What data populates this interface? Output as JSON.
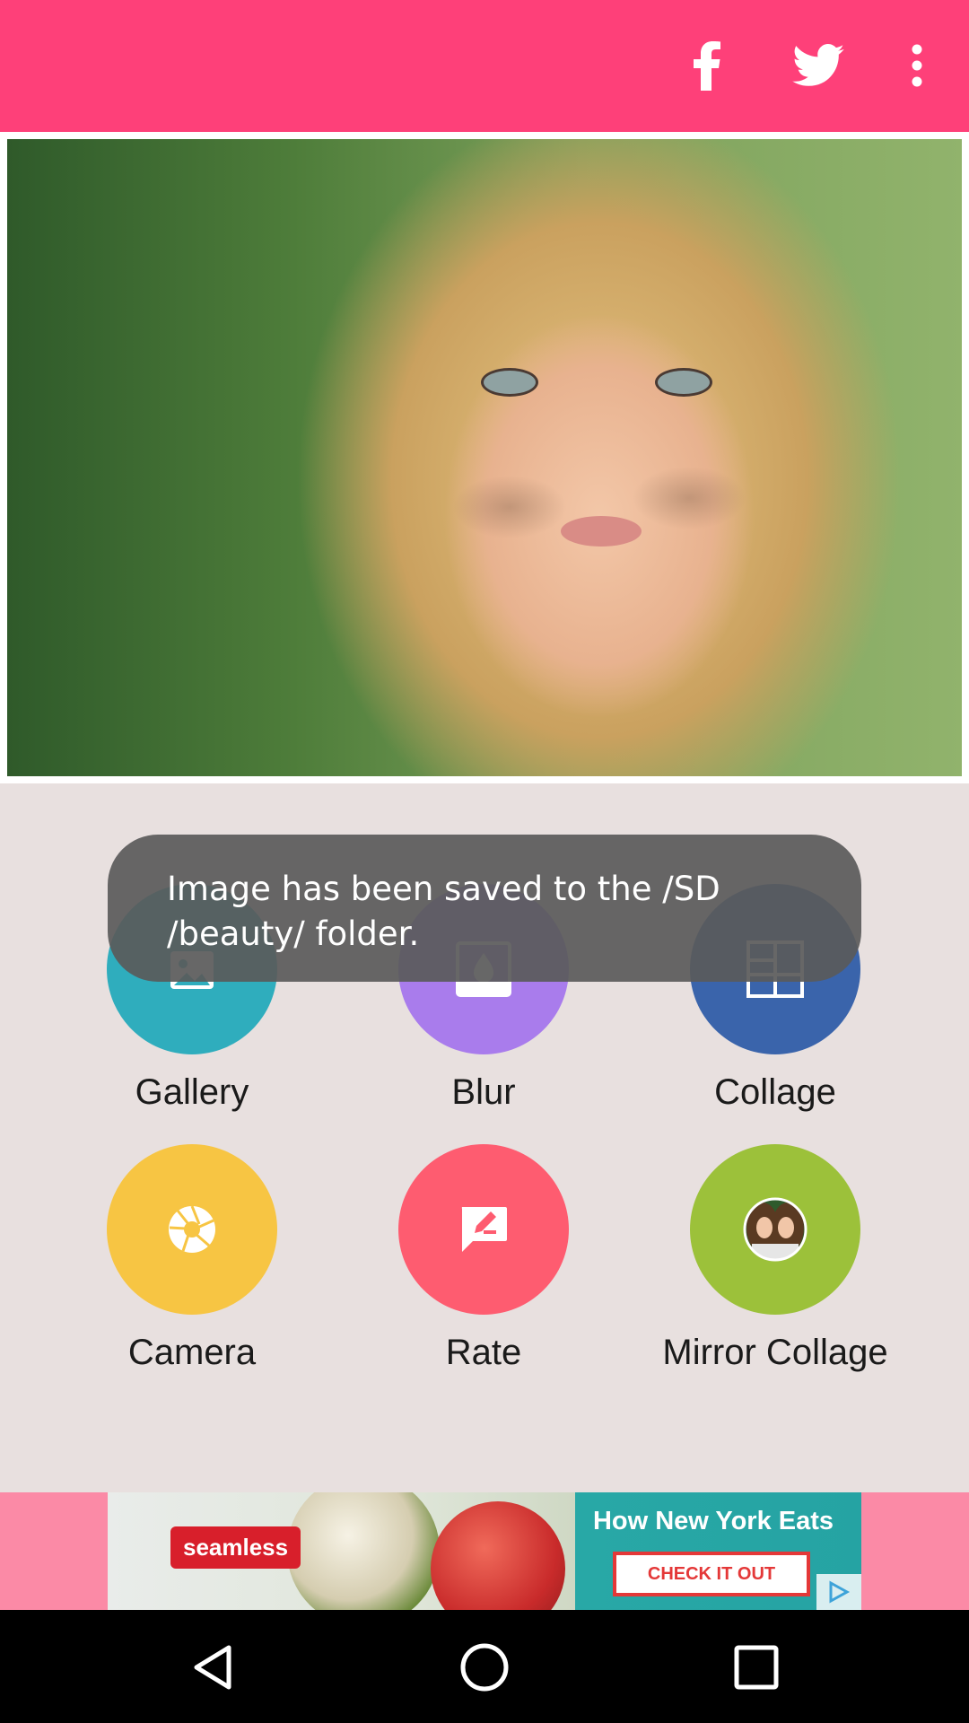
{
  "toolbar": {
    "actions": [
      {
        "name": "facebook-icon"
      },
      {
        "name": "twitter-icon"
      },
      {
        "name": "more-options-icon"
      }
    ]
  },
  "features": [
    {
      "label": "Gallery",
      "icon": "gallery-icon",
      "color": "#2fadbd"
    },
    {
      "label": "Blur",
      "icon": "blur-icon",
      "color": "#a97cec"
    },
    {
      "label": "Collage",
      "icon": "collage-icon",
      "color": "#3a64ab"
    },
    {
      "label": "Camera",
      "icon": "camera-icon",
      "color": "#f7c543"
    },
    {
      "label": "Rate",
      "icon": "rate-icon",
      "color": "#fe5c70"
    },
    {
      "label": "Mirror Collage",
      "icon": "mirror-collage-icon",
      "color": "#9cc13a"
    }
  ],
  "toast": {
    "message": "Image has been saved to the /SD /beauty/ folder."
  },
  "ad": {
    "brand": "seamless",
    "headline": "How New York Eats",
    "cta": "CHECK IT OUT"
  },
  "colors": {
    "appbar": "#fe4079",
    "background": "#e8e0df",
    "adbar": "#fb8aa6"
  }
}
